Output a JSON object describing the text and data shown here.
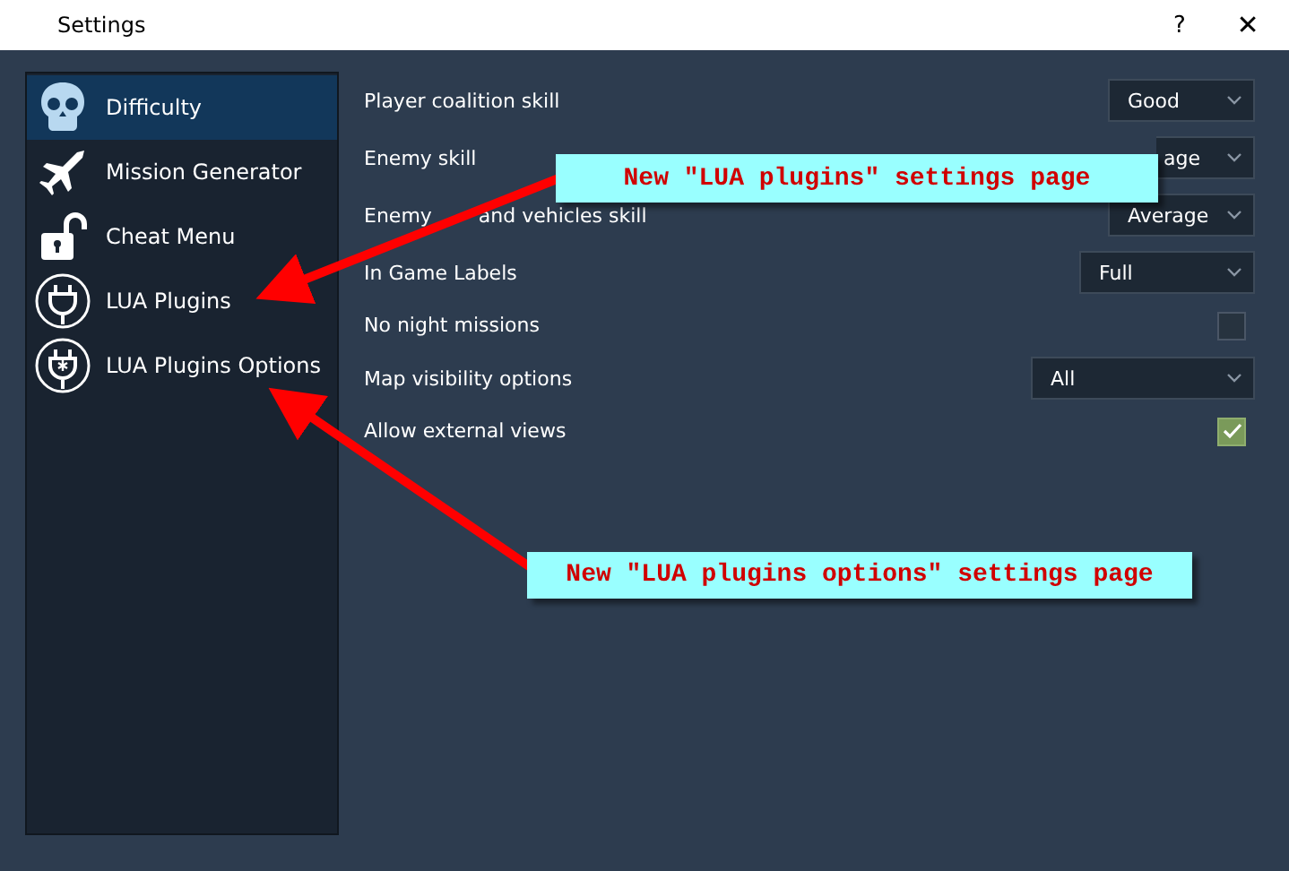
{
  "window": {
    "title": "Settings",
    "help": "?",
    "close": "✕"
  },
  "sidebar": {
    "items": [
      {
        "label": "Difficulty",
        "selected": true
      },
      {
        "label": "Mission Generator",
        "selected": false
      },
      {
        "label": "Cheat Menu",
        "selected": false
      },
      {
        "label": "LUA Plugins",
        "selected": false
      },
      {
        "label": "LUA Plugins Options",
        "selected": false
      }
    ]
  },
  "options": [
    {
      "kind": "dropdown",
      "label": "Player coalition skill",
      "value": "Good"
    },
    {
      "kind": "dropdown",
      "label": "Enemy skill",
      "value": "age"
    },
    {
      "kind": "dropdown",
      "label": "Enemy",
      "label_rest": "and vehicles skill",
      "value": "Average"
    },
    {
      "kind": "dropdown",
      "label": "In Game Labels",
      "value": "Full"
    },
    {
      "kind": "checkbox",
      "label": "No night missions",
      "checked": false
    },
    {
      "kind": "dropdown",
      "label": "Map visibility options",
      "value": "All"
    },
    {
      "kind": "checkbox",
      "label": "Allow external views",
      "checked": true
    }
  ],
  "annotations": [
    {
      "text": "New \"LUA plugins\" settings page"
    },
    {
      "text": "New \"LUA plugins options\" settings page"
    }
  ]
}
